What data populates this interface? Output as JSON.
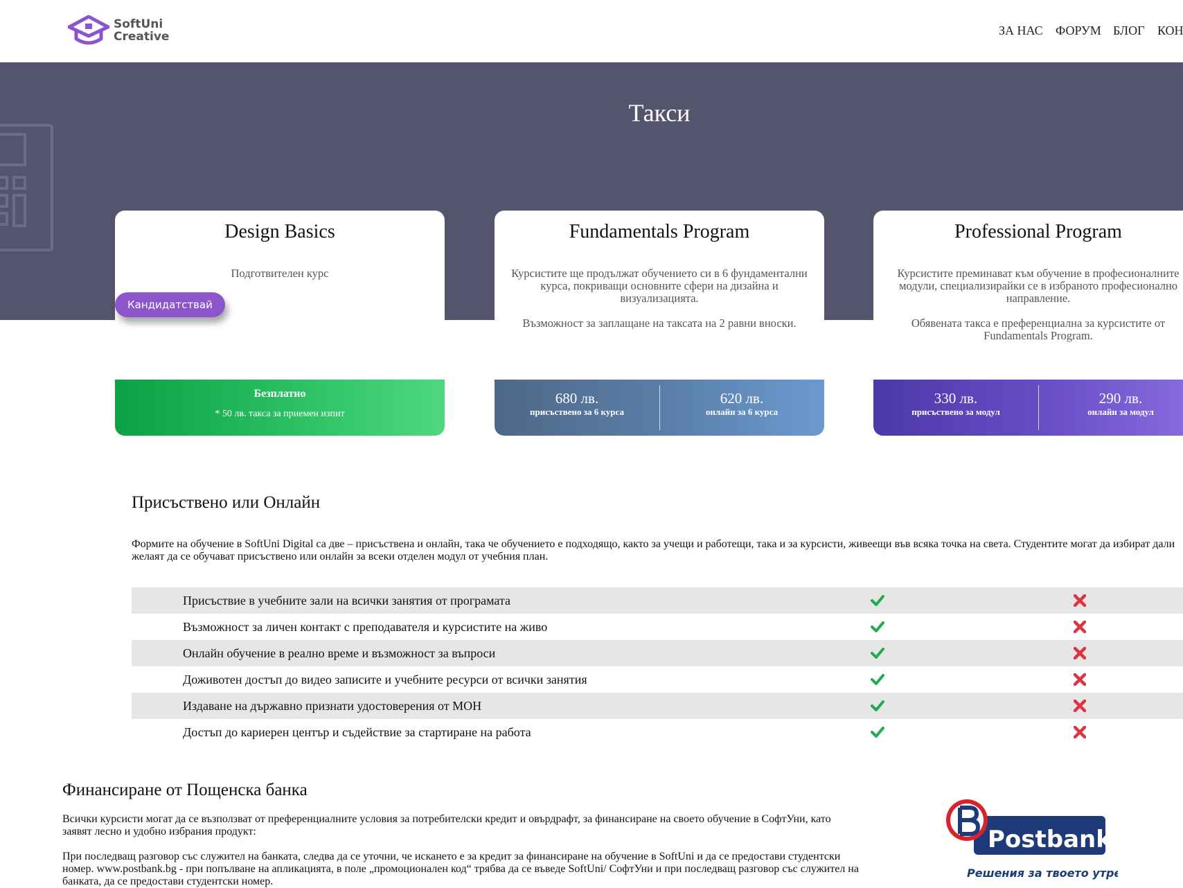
{
  "header": {
    "logo_line1": "SoftUni",
    "logo_line2": "Creative",
    "nav": [
      "ЗА НАС",
      "ФОРУМ",
      "БЛОГ",
      "КОН"
    ]
  },
  "hero": {
    "title": "Такси"
  },
  "cards": [
    {
      "title": "Design Basics",
      "desc": [
        "Подготвителен курс"
      ],
      "apply_label": "Кандидатствай",
      "price_main": "Безплатно",
      "price_note": "* 50 лв. такса за приемен изпит"
    },
    {
      "title": "Fundamentals Program",
      "desc": [
        "Курсистите ще продължат обучението си в 6 фундаментални курса, покриващи основните сфери на дизайна и визуализацията.",
        "Възможност за заплащане на таксата на 2 равни вноски."
      ],
      "prices": [
        {
          "amount": "680 лв.",
          "note": "присъствено за 6 курса"
        },
        {
          "amount": "620 лв.",
          "note": "онлайн за 6 курса"
        }
      ]
    },
    {
      "title": "Professional Program",
      "desc": [
        "Курсистите преминават към обучение в професионалните модули, специализирайки се в избраното професионално направление.",
        "Обявената такса е преференциална за курсистите от Fundamentals Program."
      ],
      "prices": [
        {
          "amount": "330 лв.",
          "note": "присъствено за модул"
        },
        {
          "amount": "290 лв.",
          "note": "онлайн за модул"
        }
      ]
    }
  ],
  "compare": {
    "title": "Присъствено или Онлайн",
    "intro": "Формите на обучение в SoftUni Digital са две – присъствена и онлайн, така че обучението е подходящо, както за учещи и работещи, така и за курсисти, живеещи във всяка точка на света. Студентите могат да избират дали желаят да се обучават присъствено или онлайн за всеки отделен модул от учебния план.",
    "rows": [
      "Присъствие в учебните зали на всички занятия от програмата",
      "Възможност за личен контакт с преподавателя и курсистите на живо",
      "Онлайн обучение в реално време и възможност за въпроси",
      "Доживотен достъп до видео записите и учебните ресурси от всички занятия",
      "Издаване на държавно признати удостоверения от МОН",
      "Достъп до кариерен център и съдействие за стартиране на работа"
    ]
  },
  "finance": {
    "title": "Финансиране от Пощенска банка",
    "p1": "Всички курсисти могат да се възползват от преференциалните условия за потребителски кредит и овърдрафт, за финансиране на своето обучение в СофтУни, като заявят лесно и удобно избрания продукт:",
    "p2": "При последващ разговор със служител на банката, следва да се уточни, че искането е за кредит за финансиране на обучение в SoftUni и да се предостави студентски номер. www.postbank.bg - при попълване на апликацията, в поле „промоционален код“ трябва да се въведе SoftUni/ СофтУни и при последващ разговор със служител на банката, да се предостави студентски номер.",
    "logo_name": "Postbank",
    "logo_tagline": "Решения за твоето утре"
  },
  "colors": {
    "hero_bg": "#54546c",
    "accent_purple": "#8c55c9",
    "check_green": "#1faa4b",
    "cross_red": "#e0333d"
  },
  "icons": [
    "graduation-cap-icon",
    "calculator-icon",
    "check-icon",
    "cross-icon"
  ]
}
